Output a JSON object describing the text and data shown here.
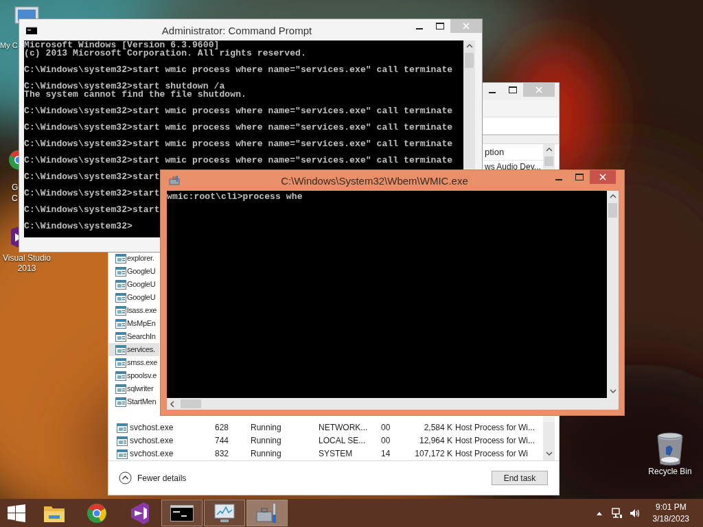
{
  "desktop_icons": [
    {
      "kind": "computer",
      "lines": [
        "My C"
      ]
    },
    {
      "kind": "browser",
      "lines": [
        "G",
        "C"
      ]
    },
    {
      "kind": "studio",
      "lines": [
        "Visual Studio",
        "2013"
      ]
    },
    {
      "kind": "recycle-bin",
      "lines": [
        "Recycle Bin"
      ]
    }
  ],
  "task_manager": {
    "header_fragment": "ption",
    "top_rows": [
      "ws Audio Dev..."
    ],
    "partial_rows": [
      {
        "name": "explorer.",
        "selected": false
      },
      {
        "name": "GoogleU",
        "selected": false
      },
      {
        "name": "GoogleU",
        "selected": false
      },
      {
        "name": "GoogleU",
        "selected": false
      },
      {
        "name": "lsass.exe",
        "selected": false
      },
      {
        "name": "MsMpEn",
        "selected": false
      },
      {
        "name": "SearchIn",
        "selected": false
      },
      {
        "name": "services.",
        "selected": true
      },
      {
        "name": "smss.exe",
        "selected": false
      },
      {
        "name": "spoolsv.e",
        "selected": false
      },
      {
        "name": "sqlwriter",
        "selected": false
      },
      {
        "name": "StartMen",
        "selected": false
      }
    ],
    "rows": [
      {
        "name": "svchost.exe",
        "pid": "628",
        "status": "Running",
        "user": "NETWORK...",
        "cpu": "00",
        "memory": "2,584 K",
        "description": "Host Process for Wi...",
        "selected": false
      },
      {
        "name": "svchost.exe",
        "pid": "744",
        "status": "Running",
        "user": "LOCAL SE...",
        "cpu": "00",
        "memory": "12,964 K",
        "description": "Host Process for Wi...",
        "selected": false
      },
      {
        "name": "svchost.exe",
        "pid": "832",
        "status": "Running",
        "user": "SYSTEM",
        "cpu": "14",
        "memory": "107,172 K",
        "description": "Host Process for Wi",
        "selected": false
      }
    ],
    "fewer_details": "Fewer details",
    "end_task": "End task"
  },
  "command_prompt": {
    "title": "Administrator:  Command Prompt",
    "active": false,
    "blocks": [
      [
        "Microsoft Windows [Version 6.3.9600]",
        "(c) 2013 Microsoft Corporation. All rights reserved."
      ],
      [
        "C:\\Windows\\system32>start wmic process where name=\"services.exe\" call terminate"
      ],
      [
        "C:\\Windows\\system32>start shutdown /a",
        "The system cannot find the file shutdown."
      ],
      [
        "C:\\Windows\\system32>start wmic process where name=\"services.exe\" call terminate"
      ],
      [
        "C:\\Windows\\system32>start wmic process where name=\"services.exe\" call terminate"
      ],
      [
        "C:\\Windows\\system32>start wmic process where name=\"services.exe\" call terminate"
      ],
      [
        "C:\\Windows\\system32>start wmic process where name=\"services.exe\" call terminate"
      ],
      [
        "C:\\Windows\\system32>start"
      ],
      [
        "C:\\Windows\\system32>start"
      ],
      [
        "C:\\Windows\\system32>start"
      ],
      [
        "C:\\Windows\\system32>"
      ]
    ]
  },
  "wmic": {
    "title": "C:\\Windows\\System32\\Wbem\\WMIC.exe",
    "active": true,
    "lines": [
      "wmic:root\\cli>process whe"
    ]
  },
  "taskbar": {
    "buttons": [
      {
        "kind": "explorer",
        "running": false,
        "selected": false
      },
      {
        "kind": "browser",
        "running": false,
        "selected": false
      },
      {
        "kind": "studio",
        "running": false,
        "selected": false
      },
      {
        "kind": "console",
        "running": true,
        "selected": false
      },
      {
        "kind": "monitor",
        "running": true,
        "selected": false
      },
      {
        "kind": "tools",
        "running": true,
        "selected": true
      }
    ],
    "clock": {
      "time": "9:01 PM",
      "date": "3/18/2023"
    }
  }
}
